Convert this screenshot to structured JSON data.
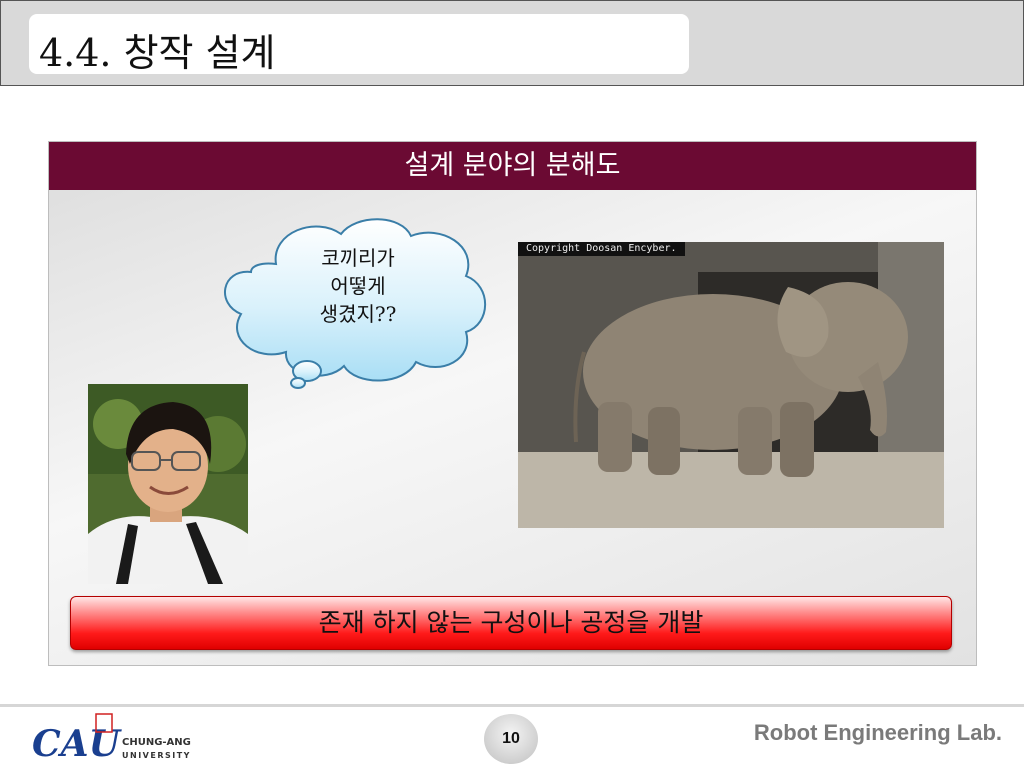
{
  "slide": {
    "title": "4.4. 창작 설계",
    "panel_header": "설계 분야의 분해도",
    "thought_text": "코끼리가\n어떻게\n생겼지??",
    "copyright": "Copyright Doosan Encyber.",
    "red_bar_text": "존재 하지 않는 구성이나 공정을 개발"
  },
  "footer": {
    "logo_text": "CAU",
    "university_line1": "CHUNG-ANG",
    "university_line2": "UNIVERSITY",
    "page_number": "10",
    "lab_name": "Robot Engineering Lab."
  },
  "colors": {
    "panel_header": "#6b0a33",
    "red_bar": "#ff1a1a",
    "logo_blue": "#1a3f8f"
  }
}
